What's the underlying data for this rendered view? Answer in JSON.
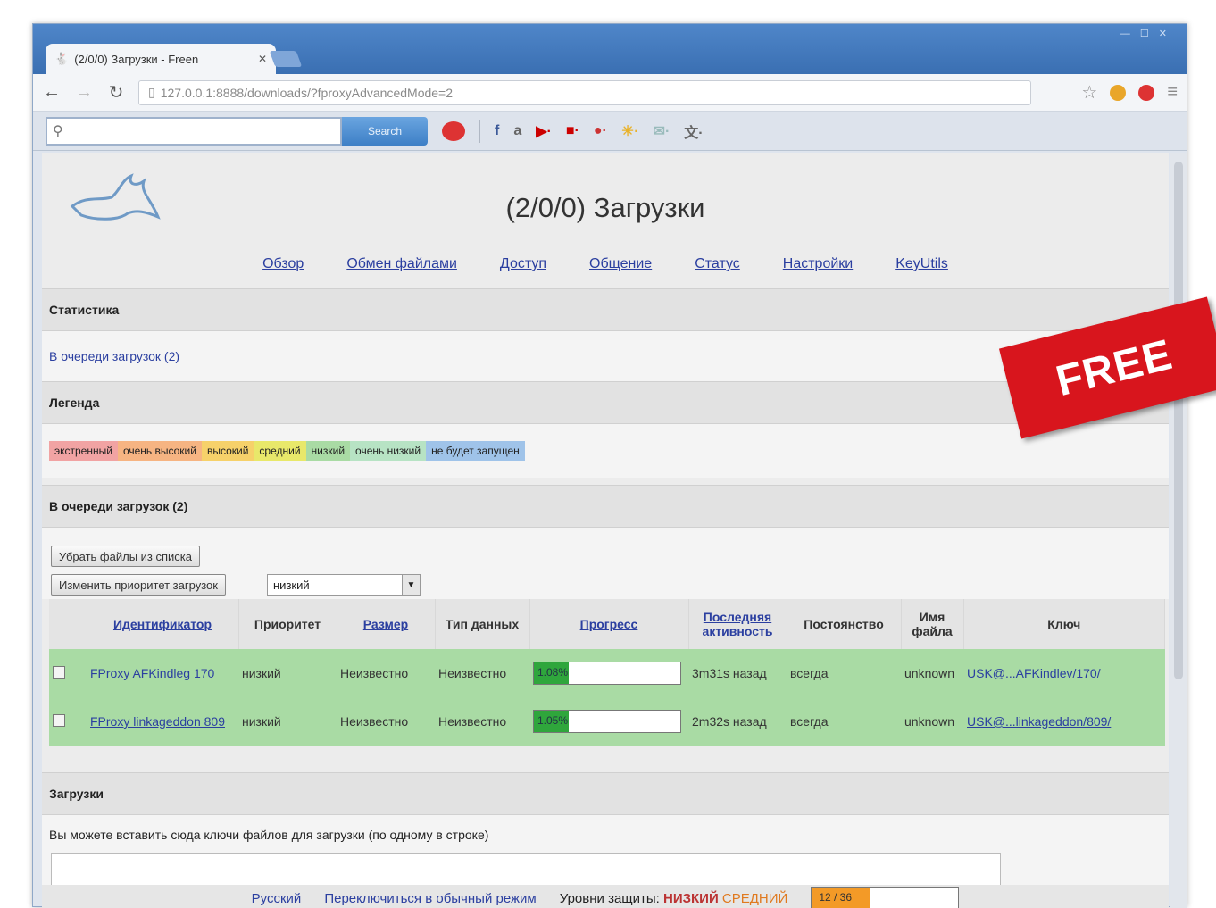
{
  "browser": {
    "tab_title": "(2/0/0) Загрузки - Freen",
    "url": "127.0.0.1:8888/downloads/?fproxyAdvancedMode=2",
    "search_button": "Search"
  },
  "page": {
    "title": "(2/0/0) Загрузки",
    "menu": [
      "Обзор",
      "Обмен файлами",
      "Доступ",
      "Общение",
      "Статус",
      "Настройки",
      "KeyUtils"
    ],
    "stats_header": "Статистика",
    "queue_link": "В очереди загрузок (2)",
    "legend_header": "Легенда",
    "legend": [
      {
        "label": "экстренный",
        "color": "#f1a3a3"
      },
      {
        "label": "очень высокий",
        "color": "#f6b482"
      },
      {
        "label": "высокий",
        "color": "#f6d16a"
      },
      {
        "label": "средний",
        "color": "#e8e86a"
      },
      {
        "label": "низкий",
        "color": "#a9dba4"
      },
      {
        "label": "очень низкий",
        "color": "#b7e3c4"
      },
      {
        "label": "не будет запущен",
        "color": "#9fc3e9"
      }
    ],
    "queue_header": "В очереди загрузок (2)",
    "remove_button": "Убрать файлы из списка",
    "priority_button": "Изменить приоритет загрузок",
    "priority_select": "низкий",
    "columns": [
      "Идентификатор",
      "Приоритет",
      "Размер",
      "Тип данных",
      "Прогресс",
      "Последняя активность",
      "Постоянство",
      "Имя файла",
      "Ключ"
    ],
    "rows": [
      {
        "id": "FProxy AFKindleg 170",
        "priority": "низкий",
        "size": "Неизвестно",
        "type": "Неизвестно",
        "progress": "1.08%",
        "progress_pct": 24,
        "activity": "3m31s назад",
        "persistence": "всегда",
        "filename": "unknown",
        "key": "USK@...AFKindlev/170/"
      },
      {
        "id": "FProxy linkageddon 809",
        "priority": "низкий",
        "size": "Неизвестно",
        "type": "Неизвестно",
        "progress": "1.05%",
        "progress_pct": 24,
        "activity": "2m32s назад",
        "persistence": "всегда",
        "filename": "unknown",
        "key": "USK@...linkageddon/809/"
      }
    ],
    "downloads_header": "Загрузки",
    "downloads_hint": "Вы можете вставить сюда ключи файлов для загрузки (по одному в строке)",
    "footer": {
      "lang": "Русский",
      "mode": "Переключиться в обычный режим",
      "security_label": "Уровни защиты:",
      "sec_low": "НИЗКИЙ",
      "sec_mid": "СРЕДНИЙ",
      "bar_text": "12 / 36",
      "bar_pct": 40
    }
  },
  "badge": "FREE"
}
